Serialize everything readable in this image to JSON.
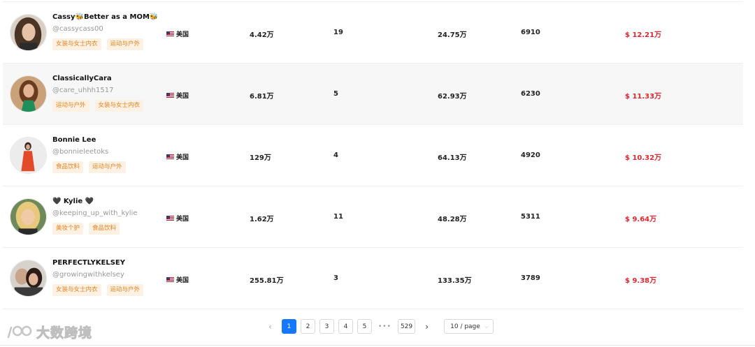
{
  "rows": [
    {
      "name": "Cassy🐝Better as a MOM🐝",
      "handle": "@cassycass00",
      "tags": [
        "女装与女士内衣",
        "运动与户外"
      ],
      "country": "美国",
      "followers": "4.42万",
      "videos": "19",
      "views": "24.75万",
      "sales": "6910",
      "revenue": "$ 12.21万"
    },
    {
      "name": "ClassicallyCara",
      "handle": "@care_uhhh1517",
      "tags": [
        "运动与户外",
        "女装与女士内衣"
      ],
      "country": "美国",
      "followers": "6.81万",
      "videos": "5",
      "views": "62.93万",
      "sales": "6230",
      "revenue": "$ 11.33万"
    },
    {
      "name": "Bonnie Lee",
      "handle": "@bonnieleetoks",
      "tags": [
        "食品饮料",
        "运动与户外"
      ],
      "country": "美国",
      "followers": "129万",
      "videos": "4",
      "views": "64.13万",
      "sales": "4920",
      "revenue": "$ 10.32万"
    },
    {
      "name": "🖤 Kylie 🖤",
      "handle": "@keeping_up_with_kylie",
      "tags": [
        "美妆个护",
        "食品饮料"
      ],
      "country": "美国",
      "followers": "1.62万",
      "videos": "11",
      "views": "48.28万",
      "sales": "5311",
      "revenue": "$ 9.64万"
    },
    {
      "name": "PERFECTLYKELSEY",
      "handle": "@growingwithkelsey",
      "tags": [
        "女装与女士内衣",
        "运动与户外"
      ],
      "country": "美国",
      "followers": "255.81万",
      "videos": "3",
      "views": "133.35万",
      "sales": "3789",
      "revenue": "$ 9.38万"
    }
  ],
  "pagination": {
    "prev": "‹",
    "pages": [
      "1",
      "2",
      "3",
      "4",
      "5"
    ],
    "dots": "•••",
    "last": "529",
    "next": "›",
    "page_size": "10 / page",
    "current": 1
  },
  "watermark": {
    "text": "大数跨境"
  },
  "colors": {
    "tag_bg": "#fdf1e3",
    "tag_text": "#e8821c",
    "revenue": "#e3262e",
    "active_page": "#1677ff",
    "alt_row": "#f7f7f7"
  }
}
